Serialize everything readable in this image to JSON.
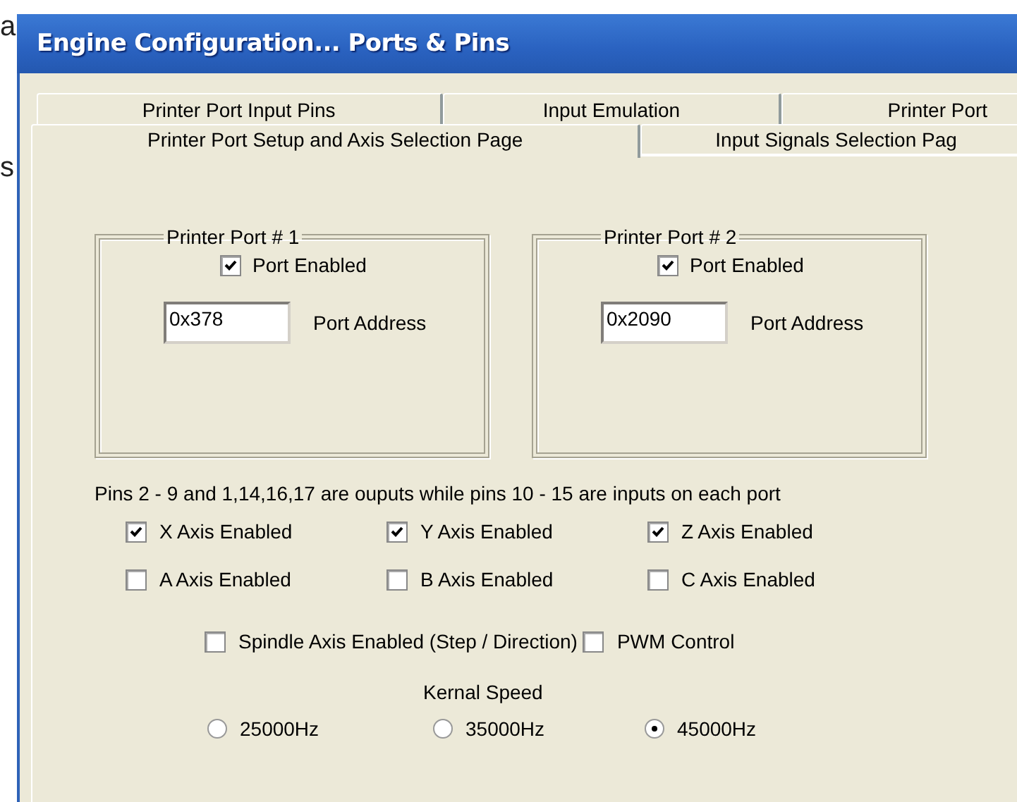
{
  "background": {
    "text_top": "a",
    "text_left": "s"
  },
  "window": {
    "title": "Engine Configuration... Ports & Pins"
  },
  "tab_rows": [
    [
      {
        "label": "Printer Port Input Pins",
        "selected": false
      },
      {
        "label": "Input Emulation",
        "selected": false
      },
      {
        "label": "Printer Port",
        "selected": false
      }
    ],
    [
      {
        "label": "Printer Port Setup and Axis Selection Page",
        "selected": true
      },
      {
        "label": "Input Signals Selection Pag",
        "selected": false
      }
    ]
  ],
  "ports": [
    {
      "title": "Printer Port # 1",
      "enabled_label": "Port Enabled",
      "checked": true,
      "address": "0x378",
      "address_label": "Port Address"
    },
    {
      "title": "Printer Port # 2",
      "enabled_label": "Port Enabled",
      "checked": true,
      "address": "0x2090",
      "address_label": "Port Address"
    }
  ],
  "note": "Pins 2 - 9 and  1,14,16,17 are ouputs while pins 10 - 15 are inputs on each port",
  "axes": [
    {
      "label": "X Axis Enabled",
      "checked": true
    },
    {
      "label": "Y Axis Enabled",
      "checked": true
    },
    {
      "label": "Z Axis Enabled",
      "checked": true
    },
    {
      "label": "A Axis Enabled",
      "checked": false
    },
    {
      "label": "B Axis Enabled",
      "checked": false
    },
    {
      "label": "C Axis Enabled",
      "checked": false
    }
  ],
  "spindle": [
    {
      "label": "Spindle Axis Enabled (Step / Direction)",
      "checked": false
    },
    {
      "label": "PWM Control",
      "checked": false
    }
  ],
  "kernel_speed": {
    "label": "Kernal Speed",
    "options": [
      {
        "label": "25000Hz",
        "selected": false
      },
      {
        "label": "35000Hz",
        "selected": false
      },
      {
        "label": "45000Hz",
        "selected": true
      }
    ]
  }
}
